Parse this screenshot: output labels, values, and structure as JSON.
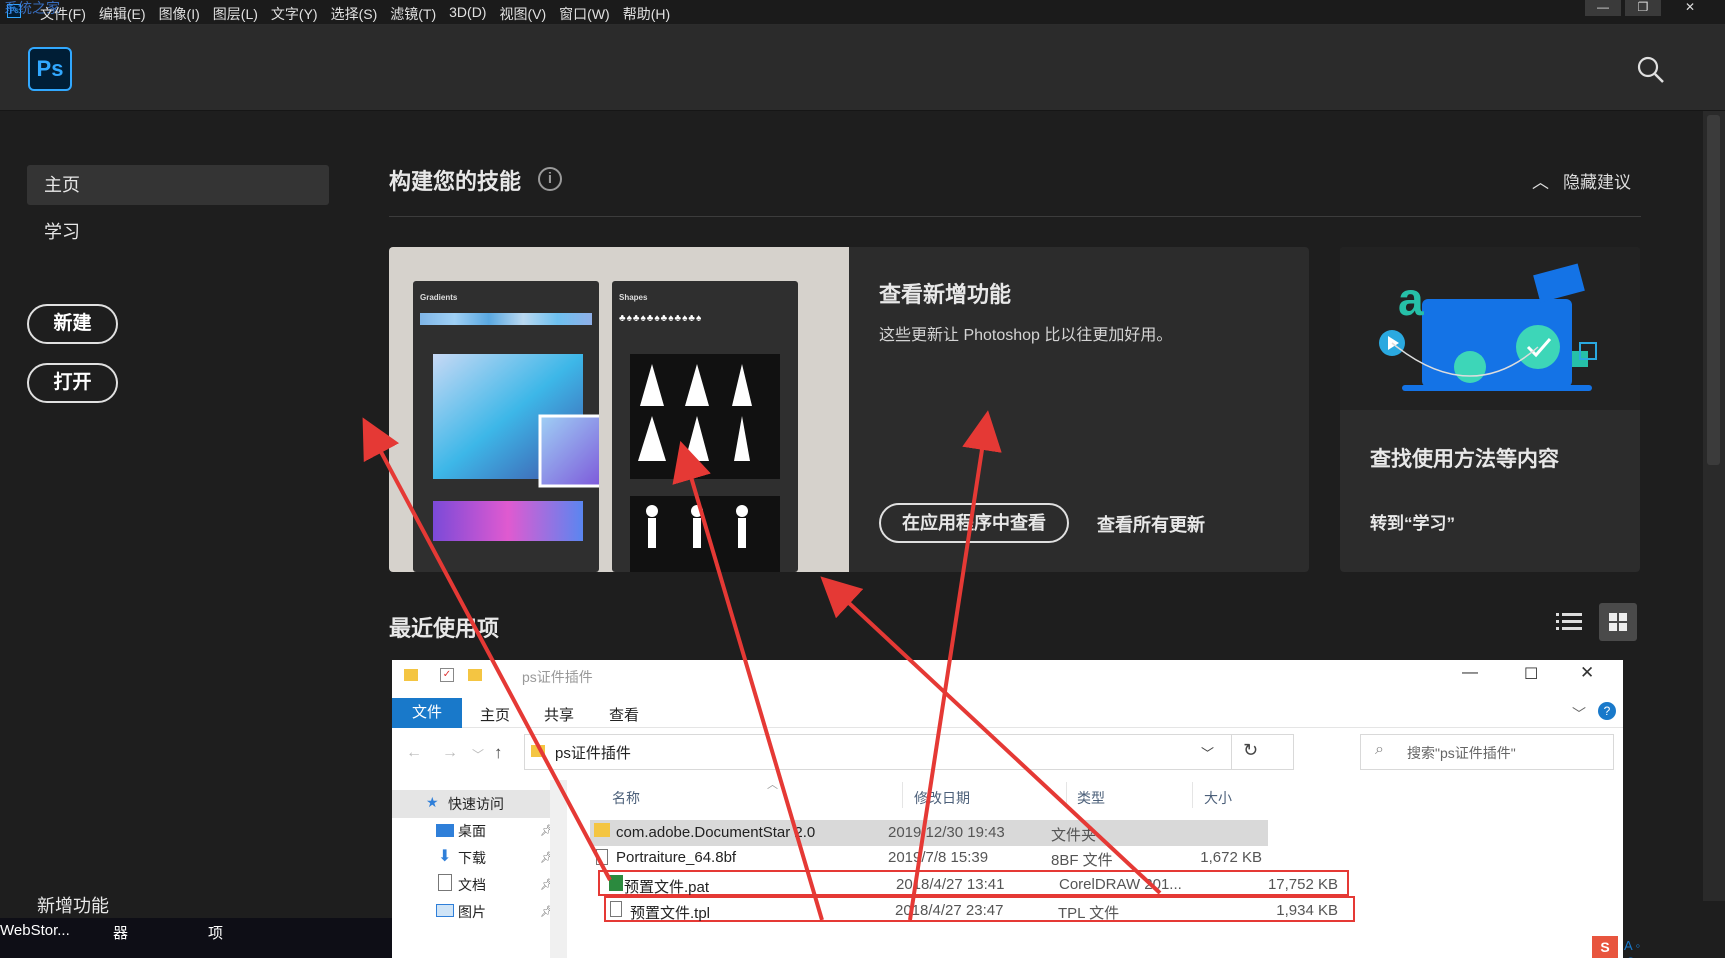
{
  "menubar": {
    "watermark": "系统之家",
    "items": [
      "文件(F)",
      "编辑(E)",
      "图像(I)",
      "图层(L)",
      "文字(Y)",
      "选择(S)",
      "滤镜(T)",
      "3D(D)",
      "视图(V)",
      "窗口(W)",
      "帮助(H)"
    ]
  },
  "header": {
    "logo": "Ps"
  },
  "sidebar": {
    "home": "主页",
    "learn": "学习",
    "new_button": "新建",
    "open_button": "打开",
    "whats_new": "新增功能"
  },
  "skills": {
    "title": "构建您的技能",
    "hide_suggestions": "隐藏建议"
  },
  "feature_card": {
    "panel_gradients": "Gradients",
    "panel_shapes": "Shapes",
    "title": "查看新增功能",
    "description": "这些更新让 Photoshop 比以往更加好用。",
    "view_in_app": "在应用程序中查看",
    "view_all": "查看所有更新"
  },
  "learn_card": {
    "title": "查找使用方法等内容",
    "link": "转到“学习”"
  },
  "recent": {
    "title": "最近使用项"
  },
  "taskbar": {
    "items": [
      "WebStor...",
      "器",
      "项"
    ]
  },
  "explorer": {
    "window_title": "ps证件插件",
    "ribbon_tabs": [
      "文件",
      "主页",
      "共享",
      "查看"
    ],
    "address": "ps证件插件",
    "search_placeholder": "搜索\"ps证件插件\"",
    "nav": [
      "快速访问",
      "桌面",
      "下载",
      "文档",
      "图片"
    ],
    "columns": [
      "名称",
      "修改日期",
      "类型",
      "大小"
    ],
    "rows": [
      {
        "name": "com.adobe.DocumentStar 2.0",
        "date": "2019/12/30 19:43",
        "type": "文件夹",
        "size": ""
      },
      {
        "name": "Portraiture_64.8bf",
        "date": "2019/7/8 15:39",
        "type": "8BF 文件",
        "size": "1,672 KB"
      },
      {
        "name": "预置文件.pat",
        "date": "2018/4/27 13:41",
        "type": "CorelDRAW 201...",
        "size": "17,752 KB"
      },
      {
        "name": "预置文件.tpl",
        "date": "2018/4/27 23:47",
        "type": "TPL 文件",
        "size": "1,934 KB"
      }
    ]
  },
  "colors": {
    "ps_blue": "#31a8ff",
    "arrow_red": "#e53935",
    "explorer_accent": "#1979ca"
  }
}
